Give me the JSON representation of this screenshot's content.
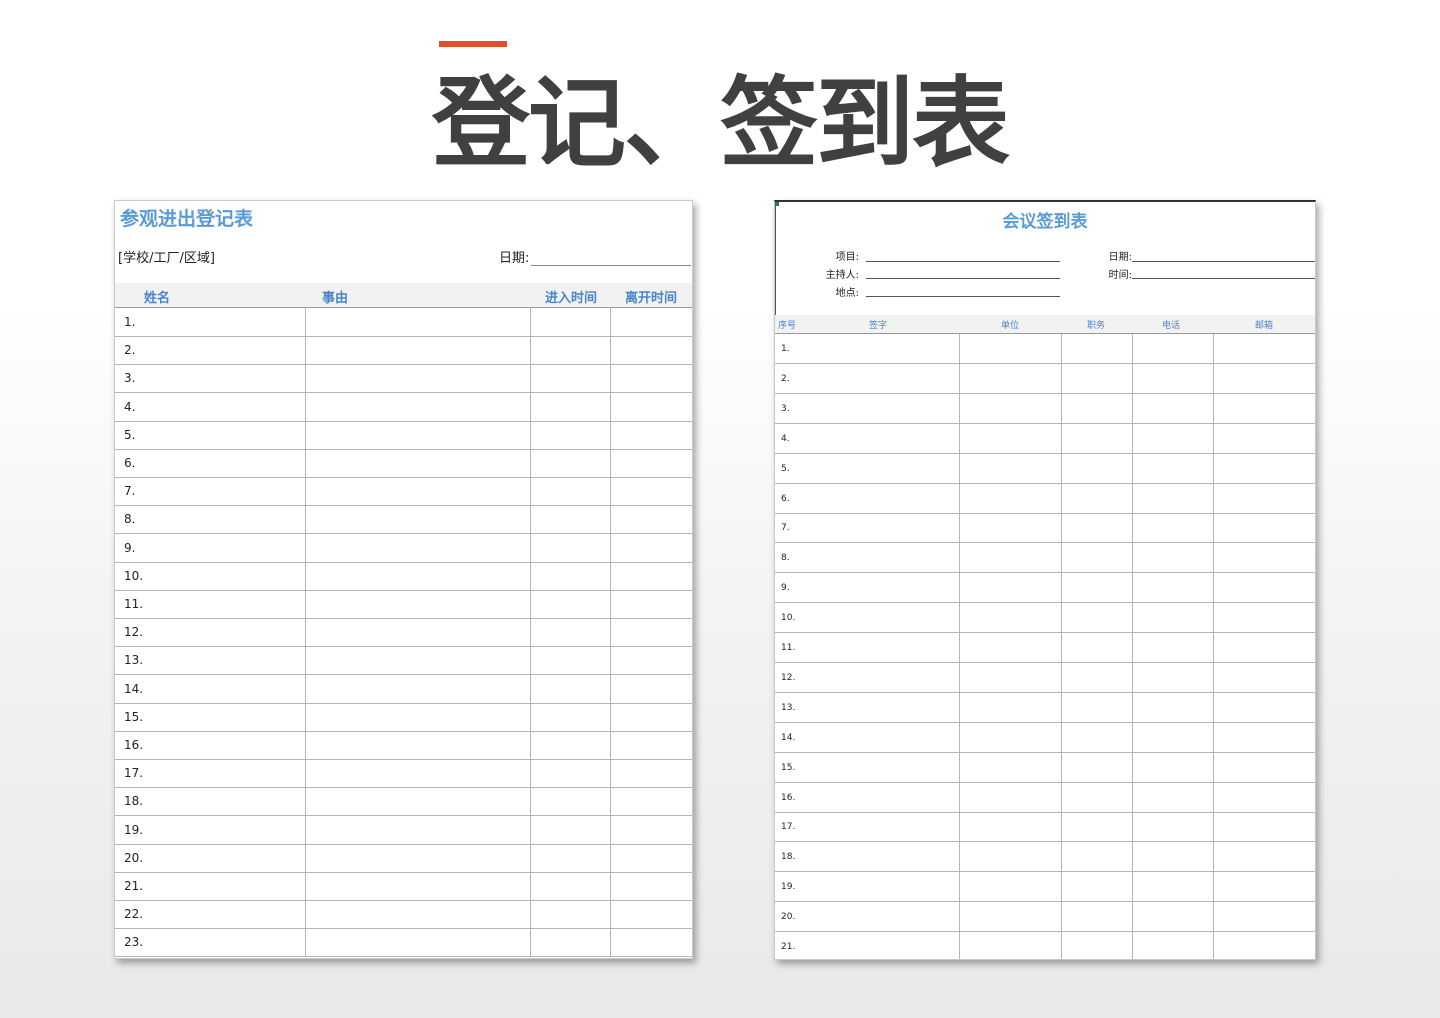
{
  "page": {
    "title": "登记、签到表",
    "accent_color": "#e0502a"
  },
  "visitor_form": {
    "title": "参观进出登记表",
    "scope_label": "[学校/工厂/区域]",
    "date_label": "日期:",
    "headers": [
      "姓名",
      "事由",
      "进入时间",
      "离开时间"
    ],
    "rows": [
      "1.",
      "2.",
      "3.",
      "4.",
      "5.",
      "6.",
      "7.",
      "8.",
      "9.",
      "10.",
      "11.",
      "12.",
      "13.",
      "14.",
      "15.",
      "16.",
      "17.",
      "18.",
      "19.",
      "20.",
      "21.",
      "22.",
      "23."
    ]
  },
  "meeting_form": {
    "title": "会议签到表",
    "fields": {
      "project": "项目:",
      "host": "主持人:",
      "location": "地点:",
      "date": "日期:",
      "time": "时间:"
    },
    "headers": [
      "序号",
      "签字",
      "单位",
      "职务",
      "电话",
      "邮箱"
    ],
    "rows": [
      "1.",
      "2.",
      "3.",
      "4.",
      "5.",
      "6.",
      "7.",
      "8.",
      "9.",
      "10.",
      "11.",
      "12.",
      "13.",
      "14.",
      "15.",
      "16.",
      "17.",
      "18.",
      "19.",
      "20.",
      "21."
    ]
  }
}
